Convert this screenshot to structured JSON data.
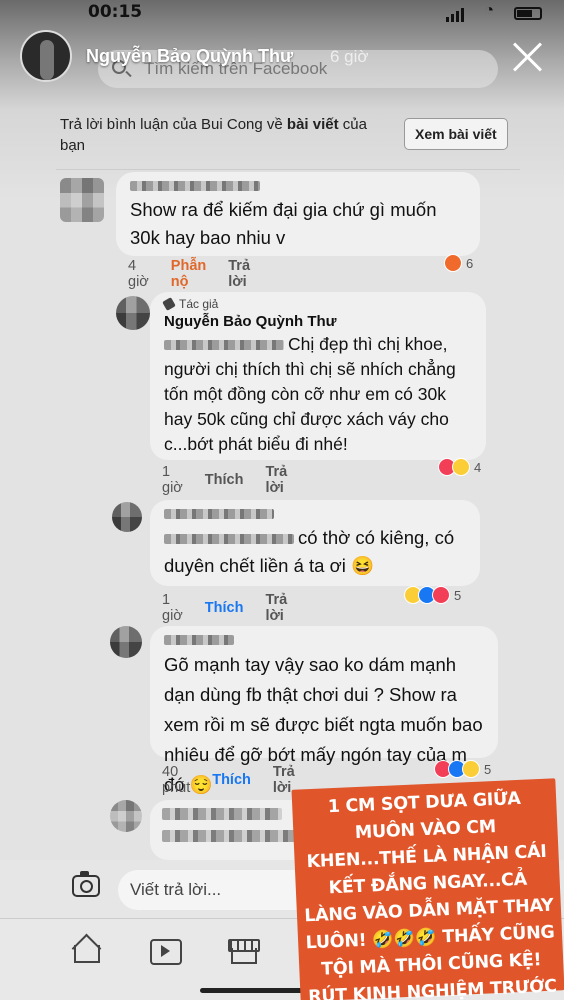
{
  "status_bar": {
    "time": "00:15"
  },
  "story": {
    "poster_name": "Nguyễn Bảo Quỳnh Thư",
    "posted_ago": "6 giờ"
  },
  "search": {
    "placeholder": "Tìm kiếm trên Facebook"
  },
  "reply_banner": {
    "text_prefix": "Trả lời bình luận của Bui Cong về ",
    "text_bold": "bài viết",
    "text_suffix": " của bạn",
    "view_post_label": "Xem bài viết"
  },
  "comments": [
    {
      "text": "Show ra để kiếm đại gia chứ gì muốn 30k hay bao nhiu v",
      "time": "4 giờ",
      "reaction_label": "Phẫn nộ",
      "reply_label": "Trả lời",
      "reaction_count": "6"
    },
    {
      "author_badge": "Tác giả",
      "author": "Nguyễn Bảo Quỳnh Thư",
      "text": "Chị đẹp thì chị khoe, người chị thích thì chị sẽ nhích chẳng tốn một đồng còn cỡ như em có 30k hay 50k cũng chỉ được xách váy cho c...bớt phát biểu đi nhé!",
      "time": "1 giờ",
      "like_label": "Thích",
      "reply_label": "Trả lời",
      "reaction_count": "4"
    },
    {
      "text": "có thờ có kiêng, có duyên chết liền á ta ơi 😆",
      "time": "1 giờ",
      "like_label": "Thích",
      "reply_label": "Trả lời",
      "reaction_count": "5"
    },
    {
      "text": "Gõ mạnh tay vậy sao ko dám mạnh dạn dùng fb thật chơi dui ? Show ra xem rồi m sẽ được biết ngta muốn bao nhiêu để gỡ bớt mấy ngón tay của m đó 😌",
      "time": "40 phút",
      "like_label": "Thích",
      "reply_label": "Trả lời",
      "reaction_count": "5"
    }
  ],
  "composer": {
    "placeholder": "Viết trả lời..."
  },
  "caption": {
    "text": "1 CM SỌT DƯA GIỮA MUÔN VÀO CM KHEN...THẾ LÀ NHẬN CÁI KẾT ĐẮNG NGAY...CẢ LÀNG VÀO DẪN MẶT THAY LUÔN! 🤣🤣🤣 THẤY CŨNG TỘI MÀ THÔI CŨNG KỆ! RÚT KINH NGHIỆM TRƯỚC KHI MỞ MỒM NHA E!"
  },
  "icons": [
    "search-icon",
    "close-icon",
    "camera-icon",
    "home-icon",
    "watch-icon",
    "marketplace-icon",
    "author-badge-icon"
  ],
  "colors": {
    "like_blue": "#1877f2",
    "angry_orange": "#e0682b",
    "caption_bg": "#e0552a"
  }
}
